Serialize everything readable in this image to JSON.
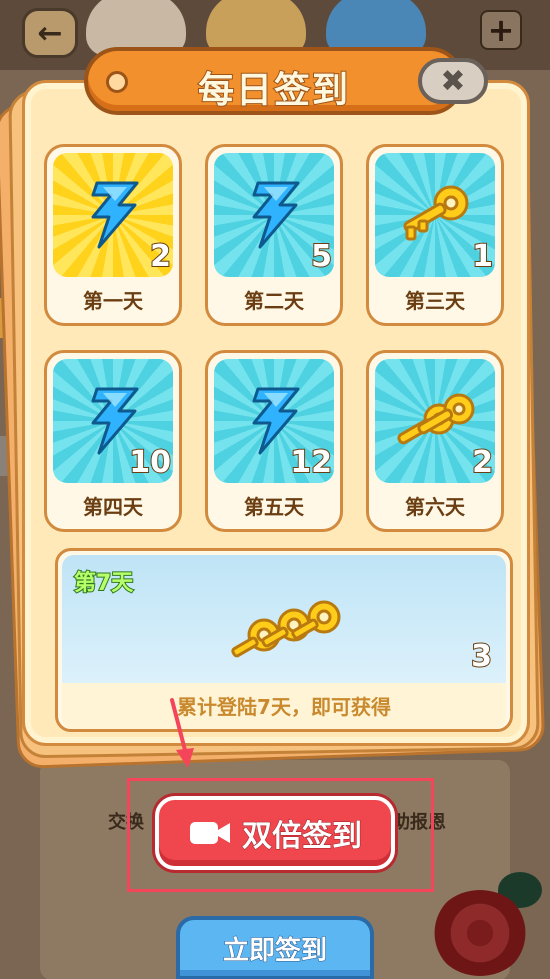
{
  "dialog": {
    "title": "每日签到",
    "close_icon": "close-x-icon"
  },
  "days": [
    {
      "label": "第一天",
      "count": "2",
      "reward_icon": "energy-bolt-icon",
      "highlight": true
    },
    {
      "label": "第二天",
      "count": "5",
      "reward_icon": "energy-bolt-icon",
      "highlight": false
    },
    {
      "label": "第三天",
      "count": "1",
      "reward_icon": "golden-key-icon",
      "highlight": false
    },
    {
      "label": "第四天",
      "count": "10",
      "reward_icon": "energy-bolt-icon",
      "highlight": false
    },
    {
      "label": "第五天",
      "count": "12",
      "reward_icon": "energy-bolt-icon",
      "highlight": false
    },
    {
      "label": "第六天",
      "count": "2",
      "reward_icon": "golden-keys-icon",
      "highlight": false
    }
  ],
  "day7": {
    "title": "第7天",
    "count": "3",
    "caption": "累计登陆7天，即可获得",
    "reward_icon": "golden-keys-icon"
  },
  "buttons": {
    "double": "双倍签到",
    "now": "立即签到"
  },
  "background": {
    "left_label": "交换",
    "right_label": "助报恩"
  },
  "colors": {
    "accent_orange": "#f3902e",
    "double_button": "#f0474e",
    "now_button": "#5bb6f2",
    "highlight_box": "#f4455a"
  }
}
